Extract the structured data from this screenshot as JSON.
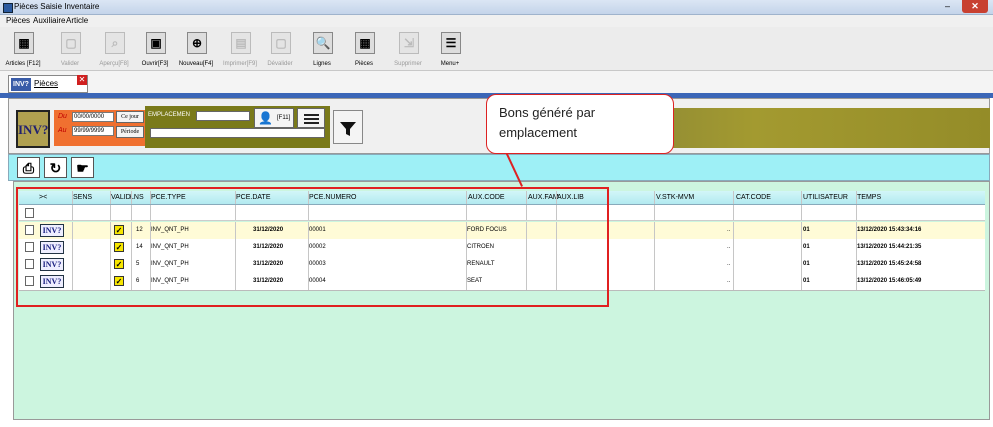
{
  "window": {
    "title": "Pièces Saisie Inventaire"
  },
  "menu": [
    "Pièces",
    "Auxiliaire",
    "Article"
  ],
  "toolbar": [
    {
      "label": "Articles [F12]",
      "icon": "articles-grid-icon",
      "enabled": true
    },
    {
      "label": "Valider",
      "icon": "validate-icon",
      "enabled": false
    },
    {
      "label": "Aperçu[F8]",
      "icon": "preview-icon",
      "enabled": false
    },
    {
      "label": "Ouvrir[F3]",
      "icon": "open-icon",
      "enabled": true
    },
    {
      "label": "Nouveau[F4]",
      "icon": "new-icon",
      "enabled": true
    },
    {
      "label": "Imprimer[F9]",
      "icon": "print-icon",
      "enabled": false
    },
    {
      "label": "Dévalider",
      "icon": "unvalidate-icon",
      "enabled": false
    },
    {
      "label": "Lignes",
      "icon": "magnifier-icon",
      "enabled": true
    },
    {
      "label": "Pièces",
      "icon": "pieces-grid-icon",
      "enabled": true
    },
    {
      "label": "Supprimer",
      "icon": "delete-icon",
      "enabled": false
    },
    {
      "label": "Menu+",
      "icon": "menu-lines-icon",
      "enabled": true
    }
  ],
  "tab": {
    "label": "Pièces",
    "logo": "INV?"
  },
  "filters": {
    "logo": "INV?",
    "du_label": "Du",
    "du_value": "00/00/0000",
    "au_label": "Au",
    "au_value": "99/99/9999",
    "ce_jour": "Ce jour",
    "periode": "Période",
    "emplacement_label": "EMPLACEMEN",
    "user_key": "[F11]"
  },
  "grid": {
    "columns": [
      "><",
      "SENS",
      "VALID",
      "LNS",
      "PCE.TYPE",
      "PCE.DATE",
      "PCE.NUMERO",
      "AUX.CODE",
      "AUX.FAM",
      "AUX.LIB",
      "V.STK-MVM",
      "CAT.CODE",
      "UTILISATEUR",
      "TEMPS"
    ],
    "rows": [
      {
        "icon": "INV?",
        "lns": "12",
        "type": "INV_QNT_PH",
        "date": "31/12/2020",
        "numero": "00001",
        "aux_code": "FORD FOCUS",
        "vstk": "..",
        "user": "01",
        "temps": "13/12/2020 15:43:34:16",
        "selected": true
      },
      {
        "icon": "INV?",
        "lns": "14",
        "type": "INV_QNT_PH",
        "date": "31/12/2020",
        "numero": "00002",
        "aux_code": "CITROEN",
        "vstk": "..",
        "user": "01",
        "temps": "13/12/2020 15:44:21:35",
        "selected": false
      },
      {
        "icon": "INV?",
        "lns": "5",
        "type": "INV_QNT_PH",
        "date": "31/12/2020",
        "numero": "00003",
        "aux_code": "RENAULT",
        "vstk": "..",
        "user": "01",
        "temps": "13/12/2020 15:45:24:58",
        "selected": false
      },
      {
        "icon": "INV?",
        "lns": "6",
        "type": "INV_QNT_PH",
        "date": "31/12/2020",
        "numero": "00004",
        "aux_code": "SEAT",
        "vstk": "..",
        "user": "01",
        "temps": "13/12/2020 15:46:05:49",
        "selected": false
      }
    ]
  },
  "callout": {
    "text": "Bons généré par emplacement"
  },
  "colors": {
    "accent_blue": "#3b66b7",
    "olive": "#7a7a1a",
    "orange": "#f07030",
    "cyan": "#9ef0f6",
    "grid_bg": "#ccf5df",
    "annotation_red": "#e02020"
  }
}
